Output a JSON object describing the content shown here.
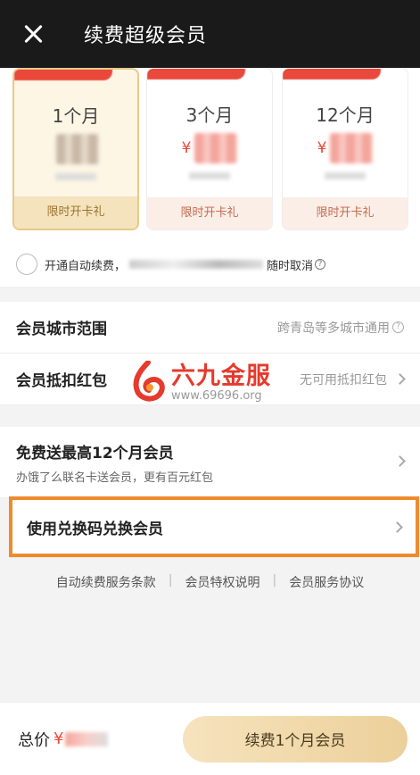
{
  "header": {
    "close_icon": "close-icon",
    "title": "续费超级会员"
  },
  "plans": [
    {
      "months": "1个月",
      "price_symbol": "",
      "gift": "限时开卡礼",
      "selected": true
    },
    {
      "months": "3个月",
      "price_symbol": "¥",
      "gift": "限时开卡礼",
      "selected": false
    },
    {
      "months": "12个月",
      "price_symbol": "¥",
      "gift": "限时开卡礼",
      "selected": false
    }
  ],
  "auto_renew": {
    "label_start": "开通自动续费，",
    "label_end": "随时取消"
  },
  "rows": {
    "city_range": {
      "label": "会员城市范围",
      "value": "跨青岛等多城市通用"
    },
    "red_packet": {
      "label": "会员抵扣红包",
      "value": "无可用抵扣红包"
    },
    "free_gift": {
      "label": "免费送最高12个月会员",
      "sub": "办饿了么联名卡送会员，更有百元红包"
    },
    "redeem": {
      "label": "使用兑换码兑换会员"
    }
  },
  "footer_links": [
    "自动续费服务条款",
    "会员特权说明",
    "会员服务协议"
  ],
  "bottom": {
    "total_label": "总价",
    "currency": "¥",
    "pay_button": "续费1个月会员"
  },
  "watermark": {
    "title": "六九金服",
    "url": "www.69696.org"
  },
  "colors": {
    "accent_red": "#e9483a",
    "gold": "#ecd09a",
    "highlight_orange": "#f08a2e"
  }
}
